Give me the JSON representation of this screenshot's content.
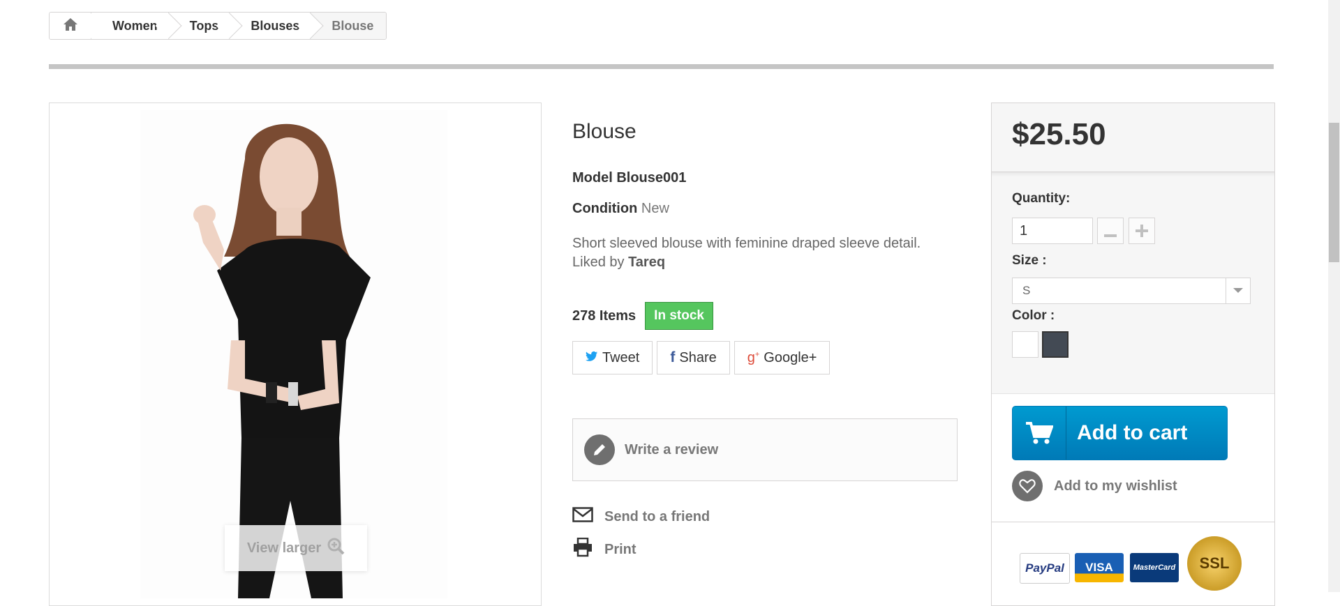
{
  "breadcrumb": {
    "home_icon": "home-icon",
    "items": [
      "Women",
      "Tops",
      "Blouses",
      "Blouse"
    ]
  },
  "image": {
    "view_larger_label": "View larger",
    "zoom_icon": "zoom-in-icon"
  },
  "product": {
    "title": "Blouse",
    "model_label": "Model",
    "model_value": "Blouse001",
    "condition_label": "Condition",
    "condition_value": "New",
    "description": "Short sleeved blouse with feminine draped sleeve detail. Liked by",
    "description_user": "Tareq",
    "quantity_text": "278 Items",
    "stock_status": "In stock"
  },
  "share": {
    "tweet": "Tweet",
    "share": "Share",
    "googleplus": "Google+"
  },
  "actions": {
    "write_review": "Write a review",
    "send_to_friend": "Send to a friend",
    "print": "Print"
  },
  "buy": {
    "price": "$25.50",
    "quantity_label": "Quantity:",
    "quantity_value": "1",
    "size_label": "Size :",
    "size_value": "S",
    "color_label": "Color :",
    "colors": [
      "#ffffff",
      "#434a54"
    ],
    "add_to_cart": "Add to cart",
    "wishlist": "Add to my wishlist"
  },
  "payment": {
    "paypal": "PayPal",
    "visa": "VISA",
    "mastercard": "MasterCard",
    "ssl": "SSL"
  },
  "colors": {
    "accent_blue": "#0084c4",
    "stock_green": "#55c65e"
  }
}
